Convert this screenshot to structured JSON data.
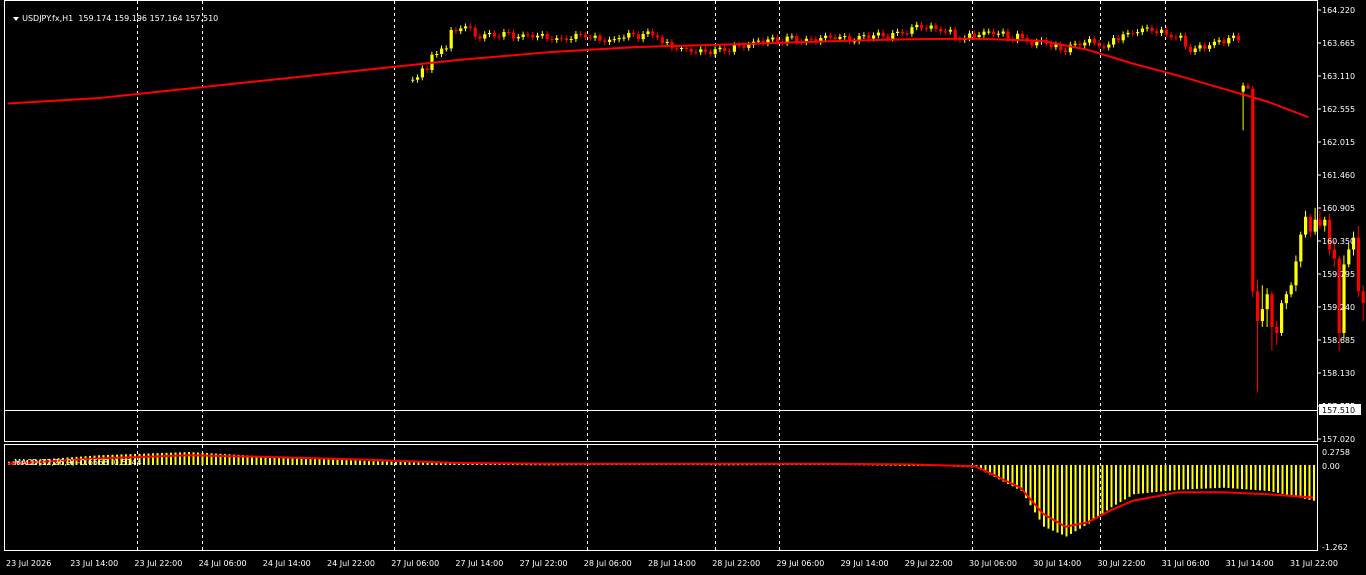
{
  "main_chart": {
    "symbol": "USDJPY.fx",
    "timeframe": "H1",
    "ohlc_text": "159.174 159.196 157.164 157.510",
    "current_price": "157.510",
    "hidden_level": "157.680",
    "price_axis": [
      "164.220",
      "163.665",
      "163.110",
      "162.555",
      "162.015",
      "161.460",
      "160.905",
      "160.350",
      "159.795",
      "159.240",
      "158.685",
      "158.130",
      "157.575",
      "157.020"
    ]
  },
  "macd_panel": {
    "title": "MACD(12,26,9)",
    "values": "-0.6568 -0.5144",
    "axis": [
      "0.2758",
      "0.00",
      "-1.262"
    ]
  },
  "time_axis": [
    "23 Jul 2026",
    "23 Jul 14:00",
    "23 Jul 22:00",
    "24 Jul 06:00",
    "24 Jul 14:00",
    "24 Jul 22:00",
    "27 Jul 06:00",
    "27 Jul 14:00",
    "27 Jul 22:00",
    "28 Jul 06:00",
    "28 Jul 14:00",
    "28 Jul 22:00",
    "29 Jul 06:00",
    "29 Jul 14:00",
    "29 Jul 22:00",
    "30 Jul 06:00",
    "30 Jul 14:00",
    "30 Jul 22:00",
    "31 Jul 06:00",
    "31 Jul 14:00",
    "31 Jul 22:00"
  ],
  "colors": {
    "background": "#000000",
    "bull": "#ffff00",
    "bear": "#ff0000",
    "ma_line": "#ff0000",
    "grid": "#ffffff",
    "text": "#ffffff"
  },
  "chart_data": [
    {
      "type": "candlestick",
      "title": "USDJPY.fx,H1",
      "ylim": [
        157.02,
        164.22
      ],
      "moving_average": {
        "x": [
          0,
          20,
          40,
          60,
          80,
          100,
          120,
          140,
          160,
          180,
          200,
          215,
          230,
          240,
          250,
          260,
          270,
          280,
          289
        ],
        "y": [
          162.65,
          162.74,
          162.9,
          163.06,
          163.22,
          163.38,
          163.51,
          163.6,
          163.64,
          163.69,
          163.73,
          163.74,
          163.7,
          163.55,
          163.32,
          163.12,
          162.9,
          162.68,
          162.42
        ]
      },
      "candles_recent": [
        {
          "o": 162.85,
          "h": 163.0,
          "l": 162.2,
          "c": 162.95
        },
        {
          "o": 162.95,
          "h": 163.0,
          "l": 162.9,
          "c": 162.9
        },
        {
          "o": 162.9,
          "h": 162.95,
          "l": 159.4,
          "c": 159.5
        },
        {
          "o": 159.5,
          "h": 159.7,
          "l": 157.8,
          "c": 159.0
        },
        {
          "o": 159.0,
          "h": 159.6,
          "l": 158.9,
          "c": 159.2
        },
        {
          "o": 159.2,
          "h": 159.55,
          "l": 158.9,
          "c": 159.45
        },
        {
          "o": 159.45,
          "h": 159.5,
          "l": 158.5,
          "c": 158.9
        },
        {
          "o": 158.9,
          "h": 159.0,
          "l": 158.6,
          "c": 158.8
        },
        {
          "o": 158.8,
          "h": 159.35,
          "l": 158.75,
          "c": 159.3
        },
        {
          "o": 159.3,
          "h": 159.5,
          "l": 159.2,
          "c": 159.45
        },
        {
          "o": 159.45,
          "h": 159.65,
          "l": 159.4,
          "c": 159.6
        },
        {
          "o": 159.6,
          "h": 160.1,
          "l": 159.5,
          "c": 160.0
        },
        {
          "o": 160.0,
          "h": 160.5,
          "l": 159.9,
          "c": 160.45
        },
        {
          "o": 160.45,
          "h": 160.85,
          "l": 160.4,
          "c": 160.75
        },
        {
          "o": 160.75,
          "h": 160.8,
          "l": 160.4,
          "c": 160.5
        },
        {
          "o": 160.5,
          "h": 160.9,
          "l": 160.45,
          "c": 160.7
        },
        {
          "o": 160.7,
          "h": 160.85,
          "l": 160.55,
          "c": 160.6
        },
        {
          "o": 160.6,
          "h": 160.75,
          "l": 160.5,
          "c": 160.7
        },
        {
          "o": 160.7,
          "h": 160.8,
          "l": 160.1,
          "c": 160.2
        },
        {
          "o": 160.2,
          "h": 160.35,
          "l": 159.9,
          "c": 160.05
        },
        {
          "o": 160.05,
          "h": 160.1,
          "l": 158.5,
          "c": 158.8
        },
        {
          "o": 158.8,
          "h": 160.1,
          "l": 158.7,
          "c": 159.95
        },
        {
          "o": 159.95,
          "h": 160.3,
          "l": 159.9,
          "c": 160.2
        },
        {
          "o": 160.2,
          "h": 160.5,
          "l": 160.1,
          "c": 160.4
        },
        {
          "o": 160.4,
          "h": 160.6,
          "l": 159.4,
          "c": 159.5
        },
        {
          "o": 159.5,
          "h": 159.6,
          "l": 159.0,
          "c": 159.3
        },
        {
          "o": 159.3,
          "h": 159.5,
          "l": 158.8,
          "c": 159.2
        },
        {
          "o": 159.2,
          "h": 159.3,
          "l": 158.9,
          "c": 159.0
        },
        {
          "o": 159.0,
          "h": 159.3,
          "l": 158.2,
          "c": 158.5
        },
        {
          "o": 158.5,
          "h": 159.0,
          "l": 158.3,
          "c": 158.95
        },
        {
          "o": 158.95,
          "h": 159.2,
          "l": 158.9,
          "c": 159.15
        },
        {
          "o": 159.174,
          "h": 159.196,
          "l": 157.164,
          "c": 157.51
        }
      ]
    },
    {
      "type": "bar",
      "title": "MACD(12,26,9)",
      "ylim": [
        -1.262,
        0.2758
      ],
      "histogram_x": [
        0,
        20,
        40,
        60,
        80,
        100,
        120,
        140,
        160,
        180,
        200,
        215,
        225,
        230,
        235,
        240,
        245,
        250,
        260,
        270,
        280,
        290
      ],
      "histogram_y": [
        0.05,
        0.15,
        0.2,
        0.12,
        0.06,
        0.02,
        0.01,
        0.02,
        0.01,
        0.02,
        0.0,
        -0.04,
        -0.4,
        -0.95,
        -1.1,
        -0.9,
        -0.65,
        -0.45,
        -0.38,
        -0.35,
        -0.4,
        -0.55
      ],
      "signal_x": [
        0,
        20,
        40,
        60,
        80,
        100,
        120,
        140,
        160,
        180,
        200,
        215,
        225,
        230,
        235,
        240,
        245,
        250,
        260,
        270,
        280,
        290
      ],
      "signal_y": [
        0.02,
        0.1,
        0.15,
        0.12,
        0.08,
        0.03,
        0.02,
        0.02,
        0.02,
        0.02,
        0.01,
        -0.02,
        -0.35,
        -0.75,
        -0.95,
        -0.88,
        -0.7,
        -0.55,
        -0.42,
        -0.42,
        -0.45,
        -0.5
      ]
    }
  ]
}
